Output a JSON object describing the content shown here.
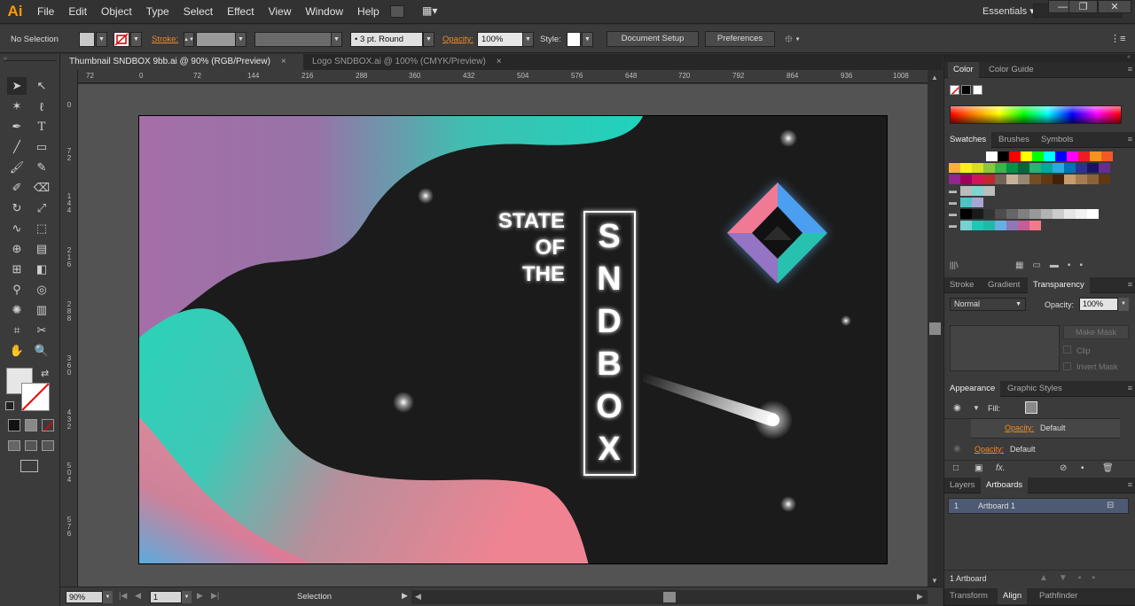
{
  "app": {
    "logo": "Ai",
    "workspace": "Essentials"
  },
  "menus": [
    "File",
    "Edit",
    "Object",
    "Type",
    "Select",
    "Effect",
    "View",
    "Window",
    "Help"
  ],
  "control_bar": {
    "selection": "No Selection",
    "stroke_label": "Stroke:",
    "brush": "3 pt. Round",
    "opacity_label": "Opacity:",
    "opacity_value": "100%",
    "style_label": "Style:",
    "doc_setup": "Document Setup",
    "preferences": "Preferences"
  },
  "tabs": [
    {
      "label": "Thumbnail SNDBOX 9bb.ai @ 90% (RGB/Preview)",
      "close": "×"
    },
    {
      "label": "Logo SNDBOX.ai @ 100% (CMYK/Preview)",
      "close": "×"
    }
  ],
  "ruler_top": [
    "72",
    "0",
    "72",
    "144",
    "216",
    "288",
    "360",
    "432",
    "504",
    "576",
    "648",
    "720",
    "792",
    "864",
    "936",
    "1008"
  ],
  "ruler_left": [
    "0",
    "7\n2",
    "1\n4\n4",
    "2\n1\n6",
    "2\n8\n8",
    "3\n6\n0",
    "4\n3\n2",
    "5\n0\n4",
    "5\n7\n6"
  ],
  "artwork": {
    "headline": [
      "STATE",
      "OF",
      "THE"
    ],
    "vertical_word": [
      "S",
      "N",
      "D",
      "B",
      "O",
      "X"
    ]
  },
  "status": {
    "zoom": "90%",
    "page": "1",
    "mode": "Selection"
  },
  "panels": {
    "color_tabs": [
      "Color",
      "Color Guide"
    ],
    "swatch_tabs": [
      "Swatches",
      "Brushes",
      "Symbols"
    ],
    "transparency_tabs": [
      "Stroke",
      "Gradient",
      "Transparency"
    ],
    "blend_mode": "Normal",
    "opacity_label": "Opacity:",
    "opacity_value": "100%",
    "make_mask": "Make Mask",
    "clip": "Clip",
    "invert_mask": "Invert Mask",
    "appearance_tabs": [
      "Appearance",
      "Graphic Styles"
    ],
    "fill_label": "Fill:",
    "opacity_row_label": "Opacity:",
    "opacity_row_value": "Default",
    "layer_tabs": [
      "Layers",
      "Artboards"
    ],
    "artboard_index": "1",
    "artboard_name": "Artboard 1",
    "artboard_count": "1 Artboard",
    "bottom_tabs": [
      "Transform",
      "Align",
      "Pathfinder"
    ]
  },
  "swatch_colors": {
    "row1": [
      "#ffffff",
      "#000000",
      "#ff0000",
      "#ffff00",
      "#00ff00",
      "#00ffff",
      "#0000ff",
      "#ff00ff",
      "#ed1c24",
      "#f7941d",
      "#f15a24"
    ],
    "row2": [
      "#fbb03b",
      "#fcee21",
      "#d9e021",
      "#8cc63f",
      "#39b54a",
      "#009245",
      "#006837",
      "#22b573",
      "#00a99d",
      "#29abe2",
      "#0071bc",
      "#2e3192",
      "#1b1464",
      "#662d91"
    ],
    "row3": [
      "#93278f",
      "#9e005d",
      "#d4145a",
      "#c1272d",
      "#736357",
      "#c7b299",
      "#998675",
      "#754c24",
      "#603813",
      "#42210b",
      "#c69c6d",
      "#a67c52",
      "#8c6239",
      "#603813"
    ],
    "row6": [
      "#000000",
      "#1a1a1a",
      "#333333",
      "#4d4d4d",
      "#666666",
      "#808080",
      "#999999",
      "#b3b3b3",
      "#cccccc",
      "#e6e6e6",
      "#f2f2f2",
      "#ffffff"
    ],
    "row7": [
      "#7ad0cf",
      "#1fc8b4",
      "#23b7a8",
      "#69aee2",
      "#8e77b6",
      "#c45d98",
      "#f07b87"
    ]
  }
}
